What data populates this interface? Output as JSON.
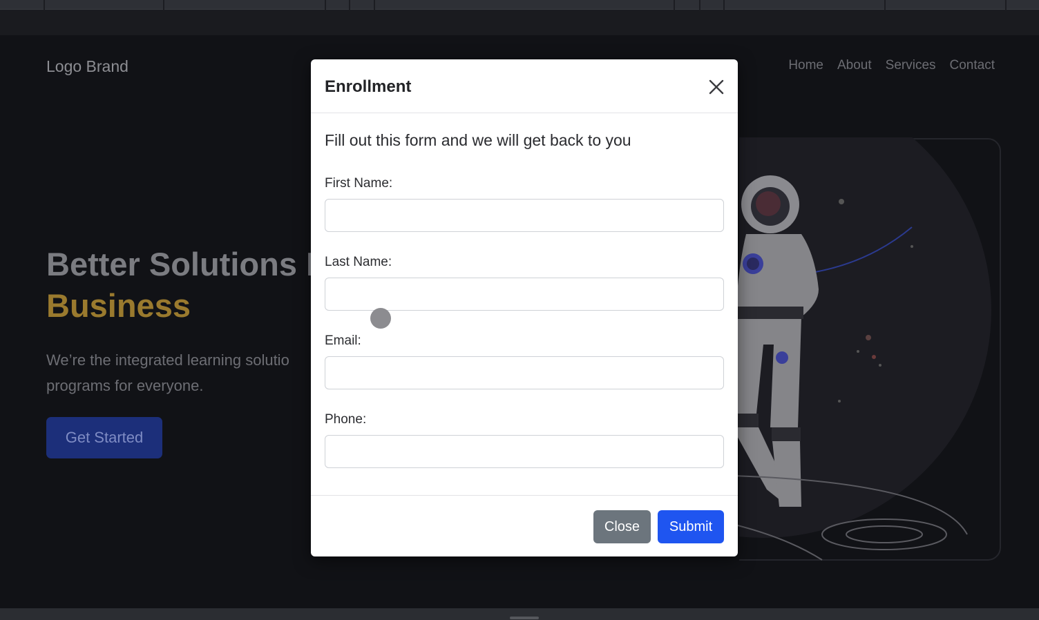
{
  "page": {
    "logo": "Logo Brand",
    "nav": [
      "Home",
      "About",
      "Services",
      "Contact"
    ],
    "hero_title_main": "Better Solutions F",
    "hero_title_accent": "Business",
    "hero_subtitle_line1": "We’re the integrated learning solutio",
    "hero_subtitle_line2": "programs for everyone.",
    "cta_label": "Get Started"
  },
  "modal": {
    "title": "Enrollment",
    "intro": "Fill out this form and we will get back to you",
    "fields": [
      {
        "label": "First Name:",
        "value": ""
      },
      {
        "label": "Last Name:",
        "value": ""
      },
      {
        "label": "Email:",
        "value": ""
      },
      {
        "label": "Phone:",
        "value": ""
      }
    ],
    "close_label": "Close",
    "submit_label": "Submit"
  },
  "colors": {
    "accent_gold": "#9a7a2e",
    "submit_blue": "#1f55f0",
    "close_gray": "#6c757d",
    "cta_blue": "#1c2f7a"
  },
  "icons": {
    "modal_close": "close-icon"
  }
}
